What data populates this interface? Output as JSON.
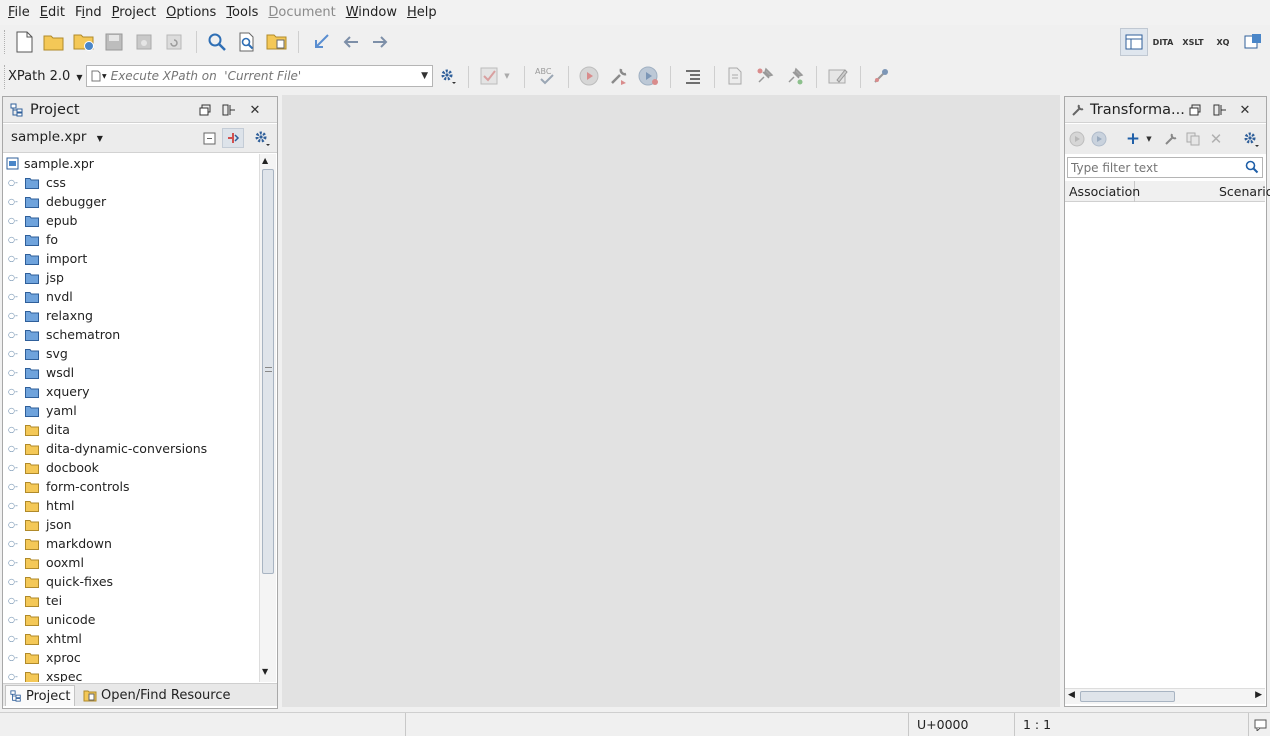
{
  "menu": [
    {
      "pre": "",
      "ul": "F",
      "post": "ile",
      "disabled": false
    },
    {
      "pre": "",
      "ul": "E",
      "post": "dit",
      "disabled": false
    },
    {
      "pre": "F",
      "ul": "i",
      "post": "nd",
      "disabled": false
    },
    {
      "pre": "",
      "ul": "P",
      "post": "roject",
      "disabled": false
    },
    {
      "pre": "",
      "ul": "O",
      "post": "ptions",
      "disabled": false
    },
    {
      "pre": "",
      "ul": "T",
      "post": "ools",
      "disabled": false
    },
    {
      "pre": "",
      "ul": "D",
      "post": "ocument",
      "disabled": true
    },
    {
      "pre": "",
      "ul": "W",
      "post": "indow",
      "disabled": false
    },
    {
      "pre": "",
      "ul": "H",
      "post": "elp",
      "disabled": false
    }
  ],
  "xpath": {
    "version_label": "XPath 2.0",
    "placeholder": "Execute XPath on  'Current File'"
  },
  "toolbar_right": [
    "DITA",
    "XSLT",
    "XQ"
  ],
  "project_panel": {
    "title": "Project",
    "project_file": "sample.xpr",
    "root": "sample.xpr",
    "items": [
      {
        "label": "css",
        "color": "blue"
      },
      {
        "label": "debugger",
        "color": "blue"
      },
      {
        "label": "epub",
        "color": "blue"
      },
      {
        "label": "fo",
        "color": "blue"
      },
      {
        "label": "import",
        "color": "blue"
      },
      {
        "label": "jsp",
        "color": "blue"
      },
      {
        "label": "nvdl",
        "color": "blue"
      },
      {
        "label": "relaxng",
        "color": "blue"
      },
      {
        "label": "schematron",
        "color": "blue"
      },
      {
        "label": "svg",
        "color": "blue"
      },
      {
        "label": "wsdl",
        "color": "blue"
      },
      {
        "label": "xquery",
        "color": "blue"
      },
      {
        "label": "yaml",
        "color": "blue"
      },
      {
        "label": "dita",
        "color": "yellow"
      },
      {
        "label": "dita-dynamic-conversions",
        "color": "yellow"
      },
      {
        "label": "docbook",
        "color": "yellow"
      },
      {
        "label": "form-controls",
        "color": "yellow"
      },
      {
        "label": "html",
        "color": "yellow"
      },
      {
        "label": "json",
        "color": "yellow"
      },
      {
        "label": "markdown",
        "color": "yellow"
      },
      {
        "label": "ooxml",
        "color": "yellow"
      },
      {
        "label": "quick-fixes",
        "color": "yellow"
      },
      {
        "label": "tei",
        "color": "yellow"
      },
      {
        "label": "unicode",
        "color": "yellow"
      },
      {
        "label": "xhtml",
        "color": "yellow"
      },
      {
        "label": "xproc",
        "color": "yellow"
      },
      {
        "label": "xspec",
        "color": "yellow"
      }
    ],
    "tabs": [
      "Project",
      "Open/Find Resource"
    ]
  },
  "transform_panel": {
    "title": "Transforma...",
    "filter_placeholder": "Type filter text",
    "columns": [
      "Association",
      "Scenario"
    ]
  },
  "status": {
    "unicode": "U+0000",
    "position": "1 : 1"
  },
  "colors": {
    "folder_blue": "#6fa3dc",
    "folder_yellow": "#f4c857",
    "editor_bg": "#e2e2e2"
  }
}
